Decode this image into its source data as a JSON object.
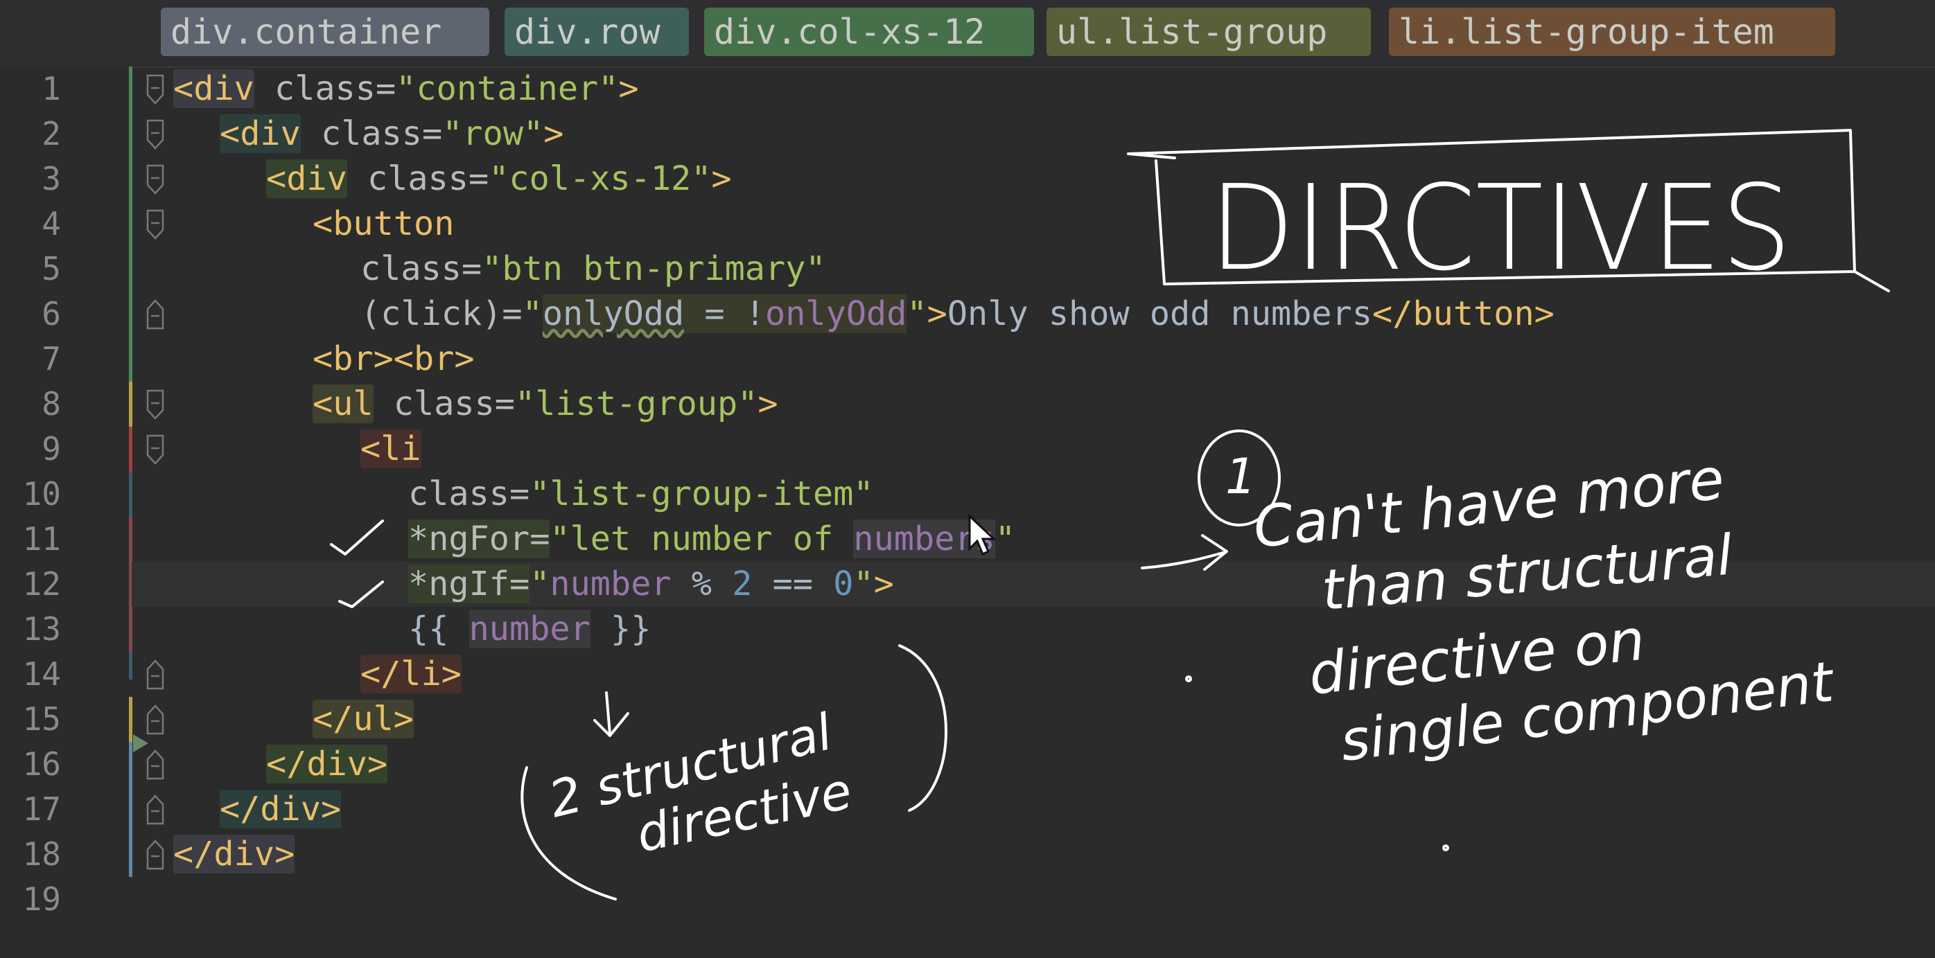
{
  "breadcrumbs": [
    {
      "label": "div.container",
      "color": "#5e6470"
    },
    {
      "label": "div.row",
      "color": "#3f5f5a"
    },
    {
      "label": "div.col-xs-12",
      "color": "#46704a"
    },
    {
      "label": "ul.list-group",
      "color": "#5a5f3a"
    },
    {
      "label": "li.list-group-item",
      "color": "#6e4f36"
    }
  ],
  "line_numbers": [
    "1",
    "2",
    "3",
    "4",
    "5",
    "6",
    "7",
    "8",
    "9",
    "10",
    "11",
    "12",
    "13",
    "14",
    "15",
    "16",
    "17",
    "18",
    "19"
  ],
  "code": {
    "l1": {
      "tag_open": "<div",
      "attr": " class=",
      "str": "\"container\"",
      "close": ">"
    },
    "l2": {
      "tag_open": "<div",
      "attr": " class=",
      "str": "\"row\"",
      "close": ">"
    },
    "l3": {
      "tag_open": "<div",
      "attr": " class=",
      "str": "\"col-xs-12\"",
      "close": ">"
    },
    "l4": {
      "tag_open": "<button"
    },
    "l5": {
      "attr": "class=",
      "str": "\"btn btn-primary\""
    },
    "l6": {
      "attr": "(click)=",
      "q1": "\"",
      "var1": "onlyOdd",
      "op": " = !",
      "var2": "onlyOdd",
      "q2": "\"",
      "close": ">",
      "text": "Only show odd numbers",
      "end": "</button>"
    },
    "l7": {
      "tag": "<br><br>"
    },
    "l8": {
      "tag_open": "<ul",
      "attr": " class=",
      "str": "\"list-group\"",
      "close": ">"
    },
    "l9": {
      "tag_open": "<li"
    },
    "l10": {
      "attr": "class=",
      "str": "\"list-group-item\""
    },
    "l11": {
      "attr": "*ngFor=",
      "str1": "\"let number of ",
      "var": "numbers",
      "str2": "\""
    },
    "l12": {
      "attr": "*ngIf=",
      "q1": "\"",
      "var": "number",
      "op": " % ",
      "n1": "2",
      "op2": " == ",
      "n2": "0",
      "q2": "\"",
      "close": ">"
    },
    "l13": {
      "open": "{{ ",
      "var": "number",
      "close": " }}"
    },
    "l14": {
      "tag": "</li>"
    },
    "l15": {
      "tag": "</ul>"
    },
    "l16": {
      "tag": "</div>"
    },
    "l17": {
      "tag": "</div>"
    },
    "l18": {
      "tag": "</div>"
    }
  },
  "annotations": {
    "title": "DIRCTIVES",
    "point_number": "1",
    "note_1": "Can't have more",
    "note_2": "than structural",
    "note_3": "directive on",
    "note_4": "single component",
    "side_1": "2 structural",
    "side_2": "directive",
    "ink_color": "#ffffff"
  },
  "colors": {
    "background": "#2b2b2b",
    "tag": "#e8bf6a",
    "string": "#a5c261",
    "variable": "#9876aa",
    "number": "#6897bb",
    "text": "#a9b7c6"
  }
}
